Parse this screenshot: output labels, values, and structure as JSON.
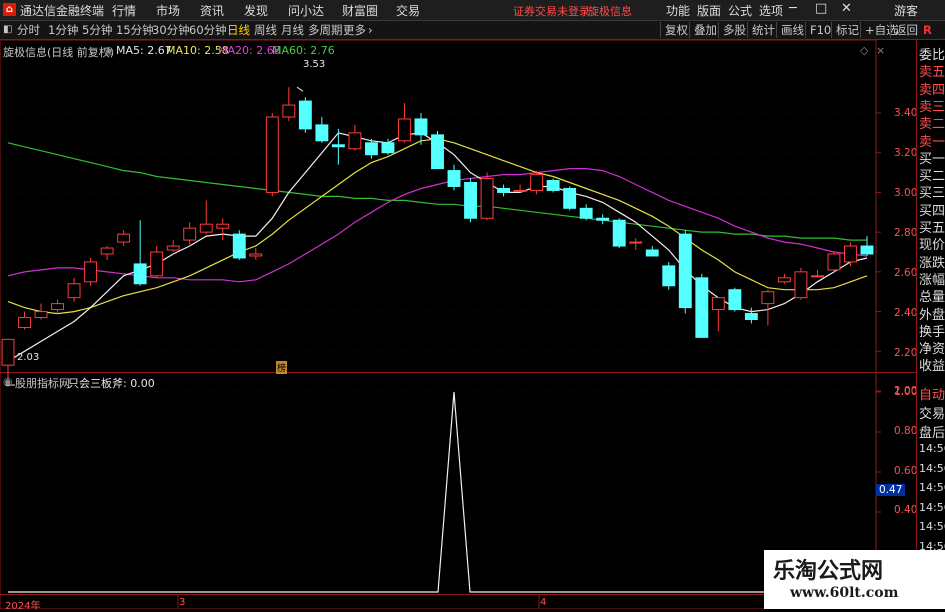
{
  "titlebar": {
    "app_name": "通达信金融终端",
    "menus": [
      "行情",
      "市场",
      "资讯",
      "发现",
      "问小达",
      "财富圈",
      "交易"
    ],
    "notice": "证券交易未登录",
    "stock_name": "旋极信息",
    "right_menus": [
      "功能",
      "版面",
      "公式",
      "选项"
    ],
    "guest": "游客"
  },
  "periodbar": {
    "periods": [
      "分时",
      "1分钟",
      "5分钟",
      "15分钟",
      "30分钟",
      "60分钟",
      "日线",
      "周线",
      "月线",
      "多周期",
      "更多"
    ],
    "active": "日线",
    "right_buttons": [
      "复权",
      "叠加",
      "多股",
      "统计",
      "画线",
      "F10",
      "标记",
      "+自选",
      "返回"
    ]
  },
  "main_chart": {
    "title": "旋极信息(日线 前复权)",
    "ma5_label": "MA5: 2.67",
    "ma10_label": "MA10: 2.58",
    "ma20_label": "MA20: 2.68",
    "ma60_label": "MA60: 2.76",
    "high_marker": "3.53",
    "low_marker": "2.03",
    "event_marker": "榜",
    "y_ticks": [
      "3.40",
      "3.20",
      "3.00",
      "2.80",
      "2.60",
      "2.40",
      "2.20",
      "2.00"
    ]
  },
  "sub_chart": {
    "title": "股朋指标网",
    "indicator": "只会三板斧: 0.00",
    "y_ticks": [
      "1.00",
      "0.80",
      "0.60",
      "0.40"
    ],
    "current_value": "0.47"
  },
  "x_axis": {
    "labels": [
      "2024年",
      "3",
      "4"
    ]
  },
  "right_panel": {
    "items": [
      "委比",
      "卖五",
      "卖四",
      "卖三",
      "卖二",
      "卖一",
      "买一",
      "买二",
      "买三",
      "买四",
      "买五",
      "现价",
      "涨跌",
      "涨幅",
      "总量",
      "外盘",
      "换手",
      "净资",
      "收益"
    ],
    "items2": [
      "自动",
      "交易",
      "盘后"
    ],
    "times": [
      "14:56",
      "14:56",
      "14:56",
      "14:56",
      "14:56",
      "14:56",
      "14:56",
      "14:56"
    ]
  },
  "watermark": {
    "title": "乐淘公式网",
    "url": "www.60lt.com"
  },
  "chart_data": {
    "type": "candlestick",
    "title": "旋极信息(日线 前复权)",
    "ylim": [
      1.95,
      3.58
    ],
    "candles": [
      [
        2.13,
        2.26,
        2.26,
        2.05
      ],
      [
        2.32,
        2.37,
        2.4,
        2.31
      ],
      [
        2.37,
        2.4,
        2.44,
        2.36
      ],
      [
        2.41,
        2.44,
        2.46,
        2.39
      ],
      [
        2.47,
        2.54,
        2.57,
        2.45
      ],
      [
        2.55,
        2.65,
        2.67,
        2.53
      ],
      [
        2.69,
        2.72,
        2.73,
        2.66
      ],
      [
        2.75,
        2.79,
        2.81,
        2.73
      ],
      [
        2.64,
        2.54,
        2.86,
        2.53
      ],
      [
        2.58,
        2.7,
        2.73,
        2.57
      ],
      [
        2.71,
        2.73,
        2.76,
        2.7
      ],
      [
        2.76,
        2.82,
        2.85,
        2.73
      ],
      [
        2.8,
        2.84,
        2.96,
        2.79
      ],
      [
        2.82,
        2.84,
        2.87,
        2.76
      ],
      [
        2.79,
        2.67,
        2.81,
        2.66
      ],
      [
        2.68,
        2.69,
        2.72,
        2.66
      ],
      [
        3.0,
        3.38,
        3.4,
        2.98
      ],
      [
        3.38,
        3.44,
        3.53,
        3.36
      ],
      [
        3.46,
        3.32,
        3.48,
        3.3
      ],
      [
        3.34,
        3.26,
        3.38,
        3.25
      ],
      [
        3.24,
        3.23,
        3.32,
        3.14
      ],
      [
        3.22,
        3.3,
        3.34,
        3.21
      ],
      [
        3.25,
        3.19,
        3.27,
        3.17
      ],
      [
        3.25,
        3.2,
        3.27,
        3.19
      ],
      [
        3.26,
        3.37,
        3.45,
        3.25
      ],
      [
        3.37,
        3.29,
        3.4,
        3.24
      ],
      [
        3.29,
        3.12,
        3.31,
        3.12
      ],
      [
        3.11,
        3.03,
        3.14,
        3.01
      ],
      [
        3.05,
        2.87,
        3.07,
        2.85
      ],
      [
        2.87,
        3.07,
        3.1,
        2.86
      ],
      [
        3.02,
        3.0,
        3.04,
        2.98
      ],
      [
        3.01,
        3.01,
        3.04,
        3.0
      ],
      [
        3.01,
        3.09,
        3.11,
        2.99
      ],
      [
        3.06,
        3.01,
        3.07,
        3.0
      ],
      [
        3.02,
        2.92,
        3.03,
        2.91
      ],
      [
        2.92,
        2.87,
        2.94,
        2.86
      ],
      [
        2.87,
        2.86,
        2.89,
        2.84
      ],
      [
        2.86,
        2.73,
        2.87,
        2.72
      ],
      [
        2.75,
        2.75,
        2.77,
        2.71
      ],
      [
        2.71,
        2.68,
        2.73,
        2.68
      ],
      [
        2.63,
        2.53,
        2.65,
        2.51
      ],
      [
        2.79,
        2.42,
        2.81,
        2.39
      ],
      [
        2.57,
        2.27,
        2.59,
        2.27
      ],
      [
        2.41,
        2.47,
        2.47,
        2.3
      ],
      [
        2.51,
        2.41,
        2.52,
        2.4
      ],
      [
        2.39,
        2.36,
        2.42,
        2.34
      ],
      [
        2.44,
        2.5,
        2.51,
        2.33
      ],
      [
        2.55,
        2.57,
        2.59,
        2.54
      ],
      [
        2.47,
        2.6,
        2.62,
        2.46
      ],
      [
        2.58,
        2.58,
        2.61,
        2.57
      ],
      [
        2.61,
        2.69,
        2.7,
        2.6
      ],
      [
        2.65,
        2.73,
        2.75,
        2.63
      ],
      [
        2.73,
        2.69,
        2.78,
        2.68
      ]
    ],
    "ma5": [
      2.15,
      2.2,
      2.25,
      2.3,
      2.35,
      2.42,
      2.5,
      2.58,
      2.61,
      2.64,
      2.69,
      2.73,
      2.78,
      2.79,
      2.78,
      2.78,
      2.87,
      3.0,
      3.1,
      3.2,
      3.3,
      3.28,
      3.26,
      3.25,
      3.29,
      3.3,
      3.25,
      3.19,
      3.1,
      3.05,
      3.0,
      3.0,
      3.03,
      3.03,
      3.0,
      2.98,
      2.95,
      2.9,
      2.85,
      2.78,
      2.71,
      2.61,
      2.53,
      2.47,
      2.42,
      2.4,
      2.41,
      2.44,
      2.49,
      2.55,
      2.6,
      2.65,
      2.67
    ],
    "ma10": [
      2.45,
      2.42,
      2.4,
      2.39,
      2.4,
      2.42,
      2.45,
      2.48,
      2.5,
      2.52,
      2.55,
      2.58,
      2.62,
      2.66,
      2.7,
      2.73,
      2.79,
      2.86,
      2.92,
      2.98,
      3.04,
      3.1,
      3.15,
      3.18,
      3.22,
      3.26,
      3.27,
      3.25,
      3.22,
      3.19,
      3.16,
      3.13,
      3.1,
      3.08,
      3.05,
      3.02,
      2.99,
      2.96,
      2.92,
      2.88,
      2.83,
      2.77,
      2.71,
      2.66,
      2.6,
      2.56,
      2.52,
      2.51,
      2.51,
      2.51,
      2.52,
      2.55,
      2.58
    ],
    "ma20": [
      2.58,
      2.6,
      2.61,
      2.62,
      2.62,
      2.61,
      2.6,
      2.59,
      2.58,
      2.57,
      2.57,
      2.56,
      2.56,
      2.56,
      2.55,
      2.56,
      2.6,
      2.64,
      2.69,
      2.74,
      2.79,
      2.85,
      2.9,
      2.95,
      2.99,
      3.02,
      3.04,
      3.06,
      3.07,
      3.08,
      3.09,
      3.09,
      3.1,
      3.11,
      3.12,
      3.12,
      3.11,
      3.08,
      3.04,
      3.0,
      2.96,
      2.93,
      2.9,
      2.87,
      2.83,
      2.8,
      2.77,
      2.75,
      2.74,
      2.72,
      2.7,
      2.69,
      2.68
    ],
    "ma60": [
      3.25,
      3.23,
      3.21,
      3.19,
      3.17,
      3.15,
      3.13,
      3.11,
      3.1,
      3.08,
      3.07,
      3.06,
      3.05,
      3.04,
      3.03,
      3.02,
      3.01,
      3.0,
      2.99,
      2.98,
      2.98,
      2.97,
      2.97,
      2.96,
      2.96,
      2.95,
      2.94,
      2.94,
      2.93,
      2.93,
      2.92,
      2.91,
      2.9,
      2.89,
      2.88,
      2.87,
      2.86,
      2.85,
      2.84,
      2.83,
      2.82,
      2.81,
      2.8,
      2.8,
      2.79,
      2.79,
      2.78,
      2.78,
      2.77,
      2.77,
      2.77,
      2.76,
      2.76
    ],
    "indicator_ylim": [
      0,
      1.0
    ],
    "indicator_values": [
      0,
      0,
      0,
      0,
      0,
      0,
      0,
      0,
      0,
      0,
      0,
      0,
      0,
      0,
      0,
      0,
      0,
      0,
      0,
      0,
      0,
      0,
      0,
      0,
      0,
      0,
      0,
      1,
      0,
      0,
      0,
      0,
      0,
      0,
      0,
      0,
      0,
      0,
      0,
      0,
      0,
      0,
      0,
      0,
      0,
      0,
      0,
      0,
      0,
      0,
      0,
      0,
      0
    ]
  }
}
